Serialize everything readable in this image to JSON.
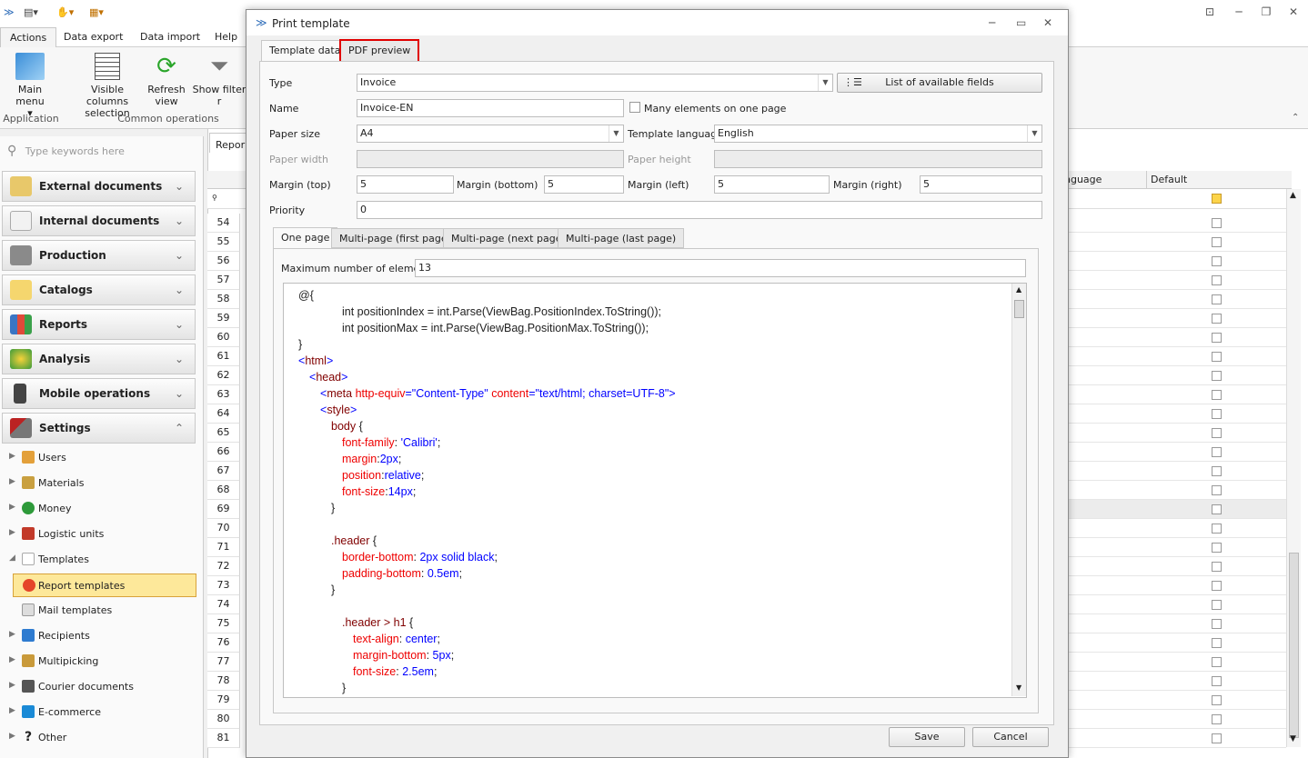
{
  "app": {
    "quick_access": [
      "",
      "",
      ""
    ],
    "window_controls": [
      "⊡",
      "─",
      "❐",
      "✕"
    ]
  },
  "menu_tabs": [
    "Actions",
    "Data export",
    "Data import",
    "Help"
  ],
  "ribbon": {
    "buttons": [
      {
        "label": "Main menu"
      },
      {
        "label": "Visible columns selection"
      },
      {
        "label": "Refresh view"
      },
      {
        "label": "Show filter r"
      }
    ],
    "groups": [
      "Application",
      "Common operations"
    ]
  },
  "left": {
    "search_placeholder": "Type keywords here",
    "categories": [
      "External documents",
      "Internal documents",
      "Production",
      "Catalogs",
      "Reports",
      "Analysis",
      "Mobile operations",
      "Settings"
    ],
    "tree": [
      "Users",
      "Materials",
      "Money",
      "Logistic units",
      "Templates",
      "Report templates",
      "Mail templates",
      "Recipients",
      "Multipicking",
      "Courier documents",
      "E-commerce",
      "Other"
    ]
  },
  "grid": {
    "tab": "Repor",
    "col_language": "nguage",
    "col_default": "Default",
    "rows": [
      "54",
      "55",
      "56",
      "57",
      "58",
      "59",
      "60",
      "61",
      "62",
      "63",
      "64",
      "65",
      "66",
      "67",
      "68",
      "69",
      "70",
      "71",
      "72",
      "73",
      "74",
      "75",
      "76",
      "77",
      "78",
      "79",
      "80",
      "81"
    ]
  },
  "dialog": {
    "title": "Print template",
    "controls": [
      "─",
      "▭",
      "✕"
    ],
    "tabs": [
      "Template data",
      "PDF preview"
    ],
    "type_label": "Type",
    "type_value": "Invoice",
    "fields_button": "List of available fields",
    "name_label": "Name",
    "name_value": "Invoice-EN",
    "many_label": "Many elements on one page",
    "paper_size_label": "Paper size",
    "paper_size_value": "A4",
    "lang_label": "Template language",
    "lang_value": "English",
    "paper_width_label": "Paper width",
    "paper_height_label": "Paper height",
    "m_top_label": "Margin (top)",
    "m_top": "5",
    "m_bottom_label": "Margin (bottom)",
    "m_bottom": "5",
    "m_left_label": "Margin (left)",
    "m_left": "5",
    "m_right_label": "Margin (right)",
    "m_right": "5",
    "priority_label": "Priority",
    "priority": "0",
    "page_tabs": [
      "One page",
      "Multi-page (first page)",
      "Multi-page (next page)",
      "Multi-page (last page)"
    ],
    "max_label": "Maximum number of elements",
    "max_value": "13",
    "save": "Save",
    "cancel": "Cancel",
    "code": [
      {
        "i": 16,
        "s": [
          [
            "p",
            "@{"
          ]
        ]
      },
      {
        "i": 64,
        "s": [
          [
            "p",
            "int positionIndex = int.Parse(ViewBag.PositionIndex.ToString());"
          ]
        ]
      },
      {
        "i": 64,
        "s": [
          [
            "p",
            "int positionMax = int.Parse(ViewBag.PositionMax.ToString());"
          ]
        ]
      },
      {
        "i": 16,
        "s": [
          [
            "p",
            "}"
          ]
        ]
      },
      {
        "i": 16,
        "s": [
          [
            "v",
            "<"
          ],
          [
            "t",
            "html"
          ],
          [
            "v",
            ">"
          ]
        ]
      },
      {
        "i": 28,
        "s": [
          [
            "v",
            "<"
          ],
          [
            "t",
            "head"
          ],
          [
            "v",
            ">"
          ]
        ]
      },
      {
        "i": 40,
        "s": [
          [
            "v",
            "<"
          ],
          [
            "t",
            "meta "
          ],
          [
            "a",
            "http-equiv"
          ],
          [
            "v",
            "=\"Content-Type\" "
          ],
          [
            "a",
            "content"
          ],
          [
            "v",
            "=\"text/html; charset=UTF-8\">"
          ]
        ]
      },
      {
        "i": 40,
        "s": [
          [
            "v",
            "<"
          ],
          [
            "t",
            "style"
          ],
          [
            "v",
            ">"
          ]
        ]
      },
      {
        "i": 52,
        "s": [
          [
            "t",
            "body "
          ],
          [
            "p",
            "{"
          ]
        ]
      },
      {
        "i": 64,
        "s": [
          [
            "a",
            "font-family"
          ],
          [
            "p",
            ": "
          ],
          [
            "v",
            "'Calibri'"
          ],
          [
            "p",
            ";"
          ]
        ]
      },
      {
        "i": 64,
        "s": [
          [
            "a",
            "margin"
          ],
          [
            "p",
            ":"
          ],
          [
            "v",
            "2px"
          ],
          [
            "p",
            ";"
          ]
        ]
      },
      {
        "i": 64,
        "s": [
          [
            "a",
            "position"
          ],
          [
            "p",
            ":"
          ],
          [
            "v",
            "relative"
          ],
          [
            "p",
            ";"
          ]
        ]
      },
      {
        "i": 64,
        "s": [
          [
            "a",
            "font-size"
          ],
          [
            "p",
            ":"
          ],
          [
            "v",
            "14px"
          ],
          [
            "p",
            ";"
          ]
        ]
      },
      {
        "i": 52,
        "s": [
          [
            "p",
            "}"
          ]
        ]
      },
      {
        "i": 52,
        "s": [
          [
            "p",
            ""
          ]
        ]
      },
      {
        "i": 52,
        "s": [
          [
            "t",
            ".header "
          ],
          [
            "p",
            "{"
          ]
        ]
      },
      {
        "i": 64,
        "s": [
          [
            "a",
            "border-bottom"
          ],
          [
            "p",
            ": "
          ],
          [
            "v",
            "2px solid black"
          ],
          [
            "p",
            ";"
          ]
        ]
      },
      {
        "i": 64,
        "s": [
          [
            "a",
            "padding-bottom"
          ],
          [
            "p",
            ": "
          ],
          [
            "v",
            "0.5em"
          ],
          [
            "p",
            ";"
          ]
        ]
      },
      {
        "i": 52,
        "s": [
          [
            "p",
            "}"
          ]
        ]
      },
      {
        "i": 52,
        "s": [
          [
            "p",
            ""
          ]
        ]
      },
      {
        "i": 64,
        "s": [
          [
            "t",
            ".header > h1 "
          ],
          [
            "p",
            "{"
          ]
        ]
      },
      {
        "i": 76,
        "s": [
          [
            "a",
            "text-align"
          ],
          [
            "p",
            ": "
          ],
          [
            "v",
            "center"
          ],
          [
            "p",
            ";"
          ]
        ]
      },
      {
        "i": 76,
        "s": [
          [
            "a",
            "margin-bottom"
          ],
          [
            "p",
            ": "
          ],
          [
            "v",
            "5px"
          ],
          [
            "p",
            ";"
          ]
        ]
      },
      {
        "i": 76,
        "s": [
          [
            "a",
            "font-size"
          ],
          [
            "p",
            ": "
          ],
          [
            "v",
            "2.5em"
          ],
          [
            "p",
            ";"
          ]
        ]
      },
      {
        "i": 64,
        "s": [
          [
            "p",
            "}"
          ]
        ]
      }
    ]
  }
}
